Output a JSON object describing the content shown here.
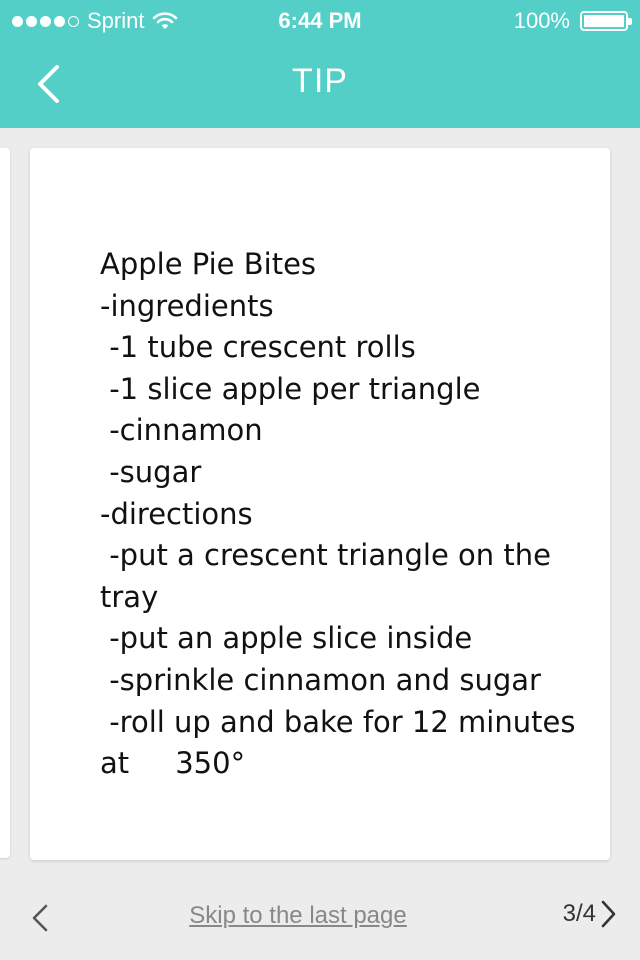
{
  "status_bar": {
    "carrier": "Sprint",
    "time": "6:44 PM",
    "battery": "100%",
    "signal_bars_filled": 4,
    "signal_bars_total": 5
  },
  "nav": {
    "title": "TIP",
    "back_icon": "chevron-left-icon"
  },
  "card": {
    "text": "Apple Pie Bites\n-ingredients\n -1 tube crescent rolls\n -1 slice apple per triangle\n -cinnamon\n -sugar\n-directions\n -put a crescent triangle on the tray\n -put an apple slice inside\n -sprinkle cinnamon and sugar\n -roll up and bake for 12 minutes at     350°"
  },
  "footer": {
    "skip_label": "Skip to the last page",
    "page_indicator": "3/4"
  },
  "colors": {
    "header": "#53cfc7",
    "background": "#ececec",
    "card": "#ffffff"
  }
}
